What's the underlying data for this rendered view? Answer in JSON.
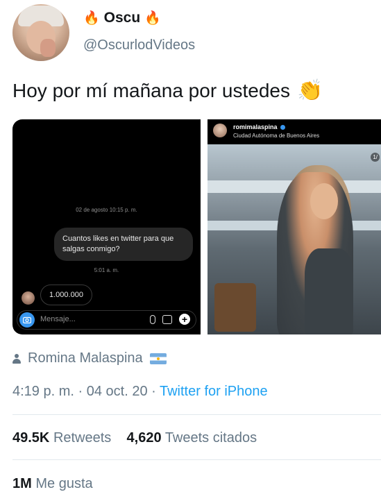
{
  "author": {
    "name": "Oscu",
    "name_emoji_left": "🔥",
    "name_emoji_right": "🔥",
    "handle": "@OscurlodVideos"
  },
  "tweet": {
    "text": "Hoy por mí mañana por ustedes",
    "emoji": "👏"
  },
  "dm_screenshot": {
    "date": "02 de agosto 10:15 p. m.",
    "question": "Cuantos likes en twitter para que salgas conmigo?",
    "time": "5:01 a. m.",
    "answer": "1.000.000",
    "input_placeholder": "Mensaje..."
  },
  "ig_post": {
    "username": "romimalaspina",
    "location": "Ciudad Autónoma de Buenos Aires",
    "page_indicator": "1/"
  },
  "tagged": {
    "name": "Romina Malaspina",
    "icon": "person-icon"
  },
  "meta": {
    "time": "4:19 p. m.",
    "date": "04 oct. 20",
    "source": "Twitter for iPhone"
  },
  "stats": {
    "retweets_count": "49.5K",
    "retweets_label": "Retweets",
    "quotes_count": "4,620",
    "quotes_label": "Tweets citados",
    "likes_count": "1M",
    "likes_label": "Me gusta"
  },
  "colors": {
    "link": "#1da1f2",
    "secondary_text": "#657786",
    "primary_text": "#14171a"
  }
}
